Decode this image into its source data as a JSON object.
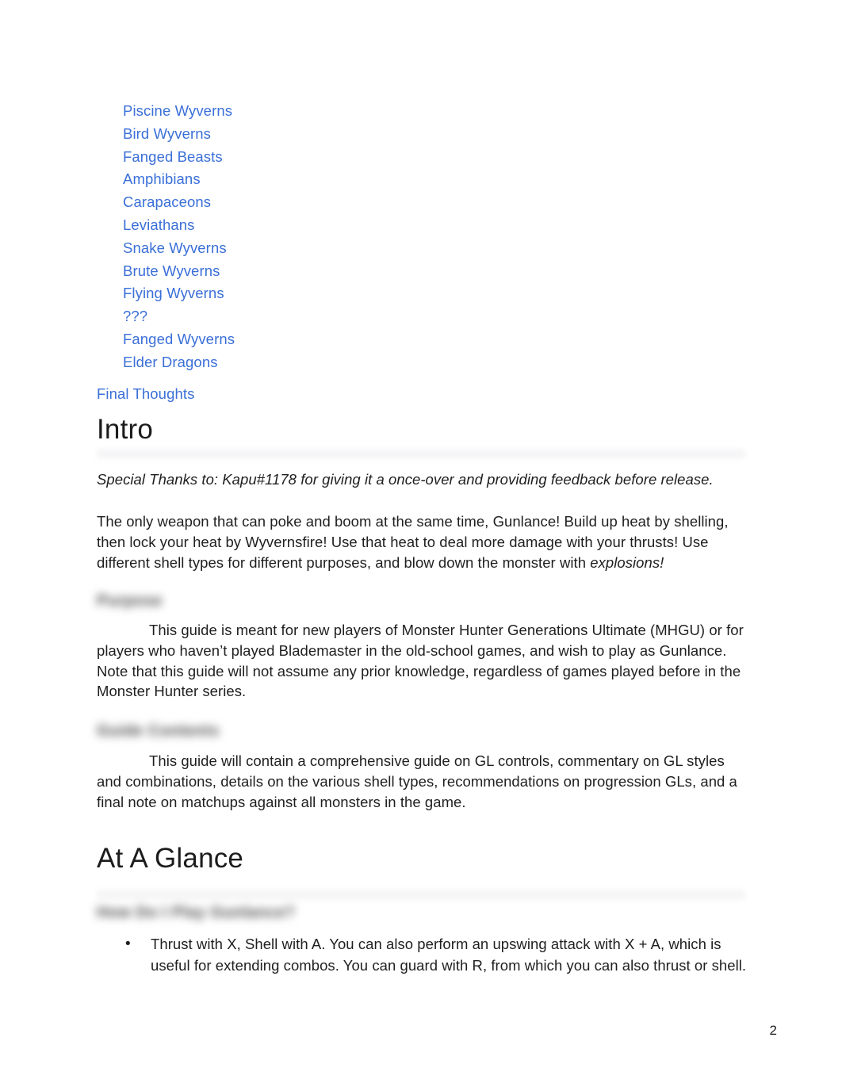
{
  "document": {
    "page_number": "2",
    "link_color": "#3a6fd8",
    "text_color": "#1f1f1f"
  },
  "toc": {
    "monster_categories": [
      {
        "label": "Piscine Wyverns"
      },
      {
        "label": "Bird Wyverns"
      },
      {
        "label": "Fanged Beasts"
      },
      {
        "label": "Amphibians"
      },
      {
        "label": "Carapaceons"
      },
      {
        "label": "Leviathans"
      },
      {
        "label": "Snake Wyverns"
      },
      {
        "label": "Brute Wyverns"
      },
      {
        "label": "Flying Wyverns"
      },
      {
        "label": "???"
      },
      {
        "label": "Fanged Wyverns"
      },
      {
        "label": "Elder Dragons"
      }
    ],
    "top_level": [
      {
        "label": "Final Thoughts"
      }
    ]
  },
  "sections": {
    "intro": {
      "heading": "Intro",
      "special_thanks": "Special Thanks to: Kapu#1178 for giving it a once-over and providing feedback before release.",
      "body_part_1": "The only weapon that can poke and boom at the same time, Gunlance! Build up heat by shelling, then lock your heat by Wyvernsfire! Use that heat to deal more damage with your thrusts! Use different shell types for different purposes, and blow down the monster with ",
      "body_emphasis": "explosions!",
      "purpose_heading": "Purpose",
      "purpose_body": "This guide is meant for new players of Monster Hunter Generations Ultimate (MHGU) or for players who haven’t played Blademaster in the old-school games, and wish to play as Gunlance. Note that this guide will not assume any prior knowledge, regardless of games played before in the Monster Hunter series.",
      "guide_contents_heading": "Guide Contents",
      "guide_contents_body": "This guide will contain a comprehensive guide on GL controls, commentary on GL styles and combinations, details on the various shell types, recommendations on progression GLs, and a final note on matchups against all monsters in the game."
    },
    "at_a_glance": {
      "heading": "At A Glance",
      "sub_heading": "How Do I Play Gunlance?",
      "bullets": [
        {
          "marker": "•",
          "text": "Thrust with X, Shell with A. You can also perform an upswing attack with X + A, which is useful for extending combos. You can guard with R, from which you can also thrust or shell."
        }
      ]
    }
  }
}
